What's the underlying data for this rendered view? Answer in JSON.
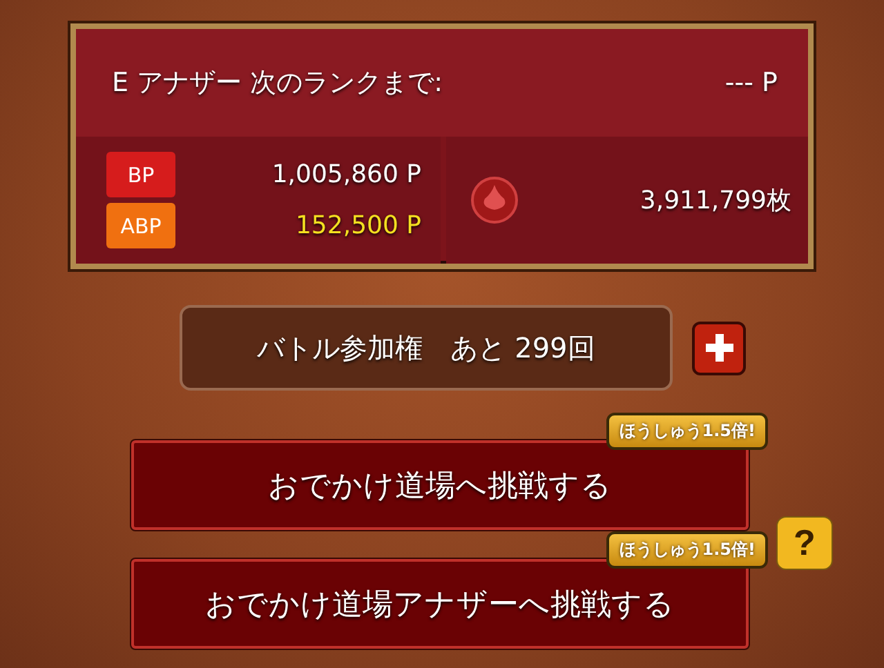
{
  "rank_panel": {
    "rank_label": "E アナザー 次のランクまで:",
    "rank_points": "--- P",
    "bp": {
      "badge": "BP",
      "value": "1,005,860 P"
    },
    "abp": {
      "badge": "ABP",
      "value": "152,500 P"
    },
    "currency": {
      "value": "3,911,799枚"
    }
  },
  "battle_tickets": {
    "label": "バトル参加権　あと 299回"
  },
  "challenges": [
    {
      "label": "おでかけ道場へ挑戦する",
      "bonus": "ほうしゅう1.5倍!"
    },
    {
      "label": "おでかけ道場アナザーへ挑戦する",
      "bonus": "ほうしゅう1.5倍!",
      "help_label": "?"
    }
  ]
}
